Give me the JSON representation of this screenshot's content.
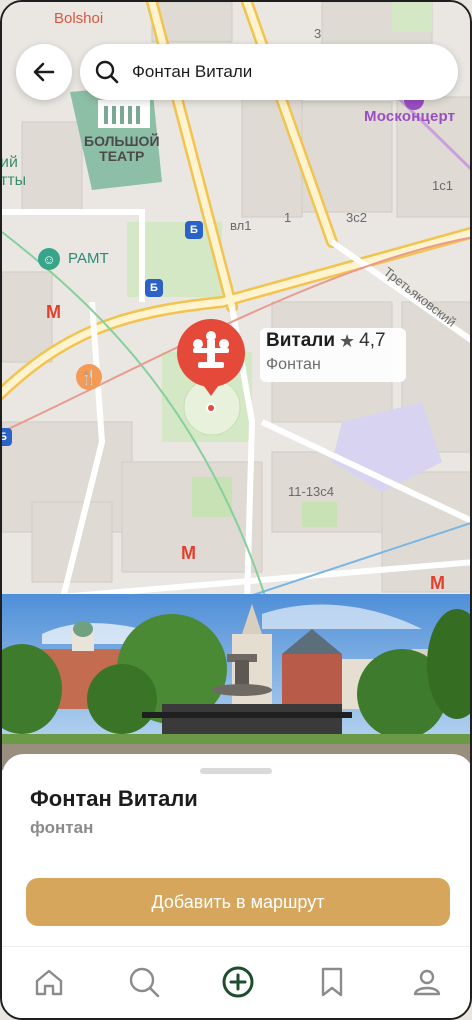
{
  "search": {
    "query": "Фонтан Витали"
  },
  "map": {
    "labels": {
      "bolshoi_en": "Bolshoi",
      "bolshoi_teatr_line1": "БОЛЬШОЙ",
      "bolshoi_teatr_line2": "ТЕАТР",
      "moskontsert": "Москонцерт",
      "ramt": "РАМТ",
      "street_tretyakovsky": "Третьяковский",
      "left_edge_1": "ий",
      "left_edge_2": "тты",
      "house_3": "3",
      "house_1": "1",
      "house_vl1": "вл1",
      "house_3s2": "3с2",
      "house_1s1": "1с1",
      "house_11_13s4": "11-13с4"
    },
    "metro_symbol": "М",
    "transit_symbol": "Б"
  },
  "poi": {
    "name": "Витали",
    "rating": "4,7",
    "type": "Фонтан"
  },
  "place": {
    "title": "Фонтан Витали",
    "subtitle": "фонтан",
    "add_to_route_label": "Добавить в маршрут"
  },
  "nav": {
    "items": [
      "home",
      "search",
      "add",
      "bookmarks",
      "profile"
    ]
  },
  "colors": {
    "accent": "#d6a65c",
    "pin": "#e5493a",
    "nav_active": "#1f4d2e"
  }
}
